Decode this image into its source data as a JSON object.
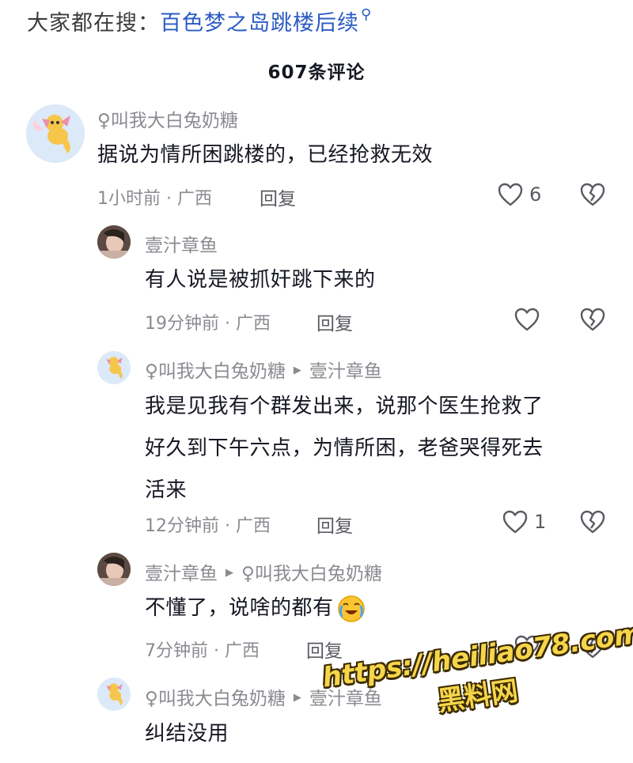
{
  "search": {
    "prefix": "大家都在搜：",
    "term": "百色梦之岛跳楼后续"
  },
  "header": {
    "comment_count": "607条评论"
  },
  "comments": [
    {
      "author": "♀叫我大白兔奶糖",
      "reply_to": "",
      "text": "据说为情所困跳楼的，已经抢救无效",
      "time_location": "1小时前 · 广西",
      "reply_label": "回复",
      "likes": "6",
      "avatar": "candy-avatar"
    },
    {
      "author": "壹汁章鱼",
      "reply_to": "",
      "text": "有人说是被抓奸跳下来的",
      "time_location": "19分钟前 · 广西",
      "reply_label": "回复",
      "likes": "",
      "avatar": "photo-avatar"
    },
    {
      "author": "♀叫我大白兔奶糖",
      "reply_to": "壹汁章鱼",
      "text_lines": [
        "我是见我有个群发出来，说那个医生抢救了",
        "好久到下午六点，为情所困，老爸哭得死去",
        "活来"
      ],
      "time_location": "12分钟前 · 广西",
      "reply_label": "回复",
      "likes": "1",
      "avatar": "candy-avatar"
    },
    {
      "author": "壹汁章鱼",
      "reply_to": "♀叫我大白兔奶糖",
      "text": "不懂了，说啥的都有",
      "emoji": "😭",
      "time_location": "7分钟前 · 广西",
      "reply_label": "回复",
      "likes": "",
      "avatar": "photo-avatar"
    },
    {
      "author": "♀叫我大白兔奶糖",
      "reply_to": "壹汁章鱼",
      "text": "纠结没用",
      "avatar": "candy-avatar"
    }
  ],
  "watermark": {
    "url": "https://heiliao78.com",
    "name": "黑料网"
  },
  "colors": {
    "link_blue": "#2a5ac4",
    "meta_gray": "#8a8b91",
    "watermark_yellow": "#f7d54a"
  }
}
